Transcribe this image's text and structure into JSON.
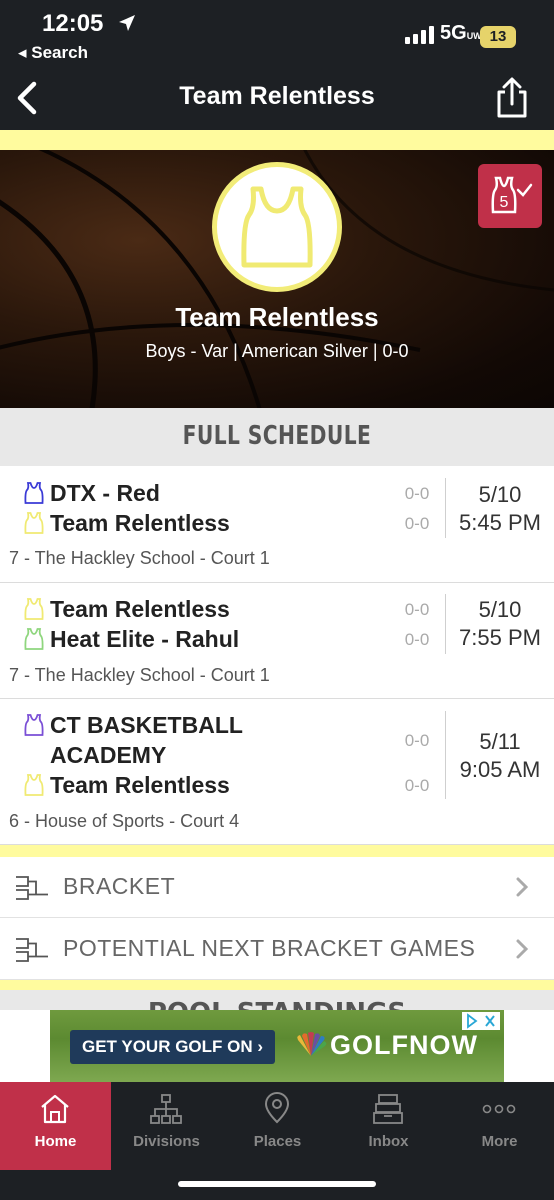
{
  "status": {
    "time": "12:05",
    "back_app": "◂ Search",
    "network": "5G",
    "network_sub": "UW",
    "battery": "13"
  },
  "nav": {
    "title": "Team Relentless"
  },
  "hero": {
    "team_name": "Team Relentless",
    "subtitle": "Boys - Var | American Silver | 0-0",
    "badge_number": "5"
  },
  "schedule": {
    "header": "FULL SCHEDULE",
    "games": [
      {
        "team1": "DTX - Red",
        "team1_color": "#3a3ad6",
        "score1": "0-0",
        "team2": "Team Relentless",
        "team2_color": "#f0ea72",
        "score2": "0-0",
        "date": "5/10",
        "time": "5:45 PM",
        "venue": "7 - The Hackley School - Court 1"
      },
      {
        "team1": "Team Relentless",
        "team1_color": "#f0ea72",
        "score1": "0-0",
        "team2": "Heat Elite - Rahul",
        "team2_color": "#8fd67e",
        "score2": "0-0",
        "date": "5/10",
        "time": "7:55 PM",
        "venue": "7 - The Hackley School - Court 1"
      },
      {
        "team1": "CT BASKETBALL ACADEMY",
        "team1_color": "#7a4fd6",
        "score1": "0-0",
        "team2": "Team Relentless",
        "team2_color": "#f0ea72",
        "score2": "0-0",
        "date": "5/11",
        "time": "9:05 AM",
        "venue": "6 - House of Sports - Court 4"
      }
    ]
  },
  "bracket": {
    "item1": "BRACKET",
    "item2": "POTENTIAL NEXT BRACKET GAMES"
  },
  "pool": {
    "header_partial": "POOL STANDINGS"
  },
  "ad": {
    "button": "GET YOUR GOLF ON ›",
    "brand": "GOLFNOW"
  },
  "tabs": [
    {
      "label": "Home",
      "icon": "home-icon"
    },
    {
      "label": "Divisions",
      "icon": "divisions-icon"
    },
    {
      "label": "Places",
      "icon": "map-pin-icon"
    },
    {
      "label": "Inbox",
      "icon": "inbox-icon"
    },
    {
      "label": "More",
      "icon": "more-icon"
    }
  ],
  "colors": {
    "accent": "#c03049",
    "highlight": "#fffb9e",
    "dark": "#1d2024"
  }
}
